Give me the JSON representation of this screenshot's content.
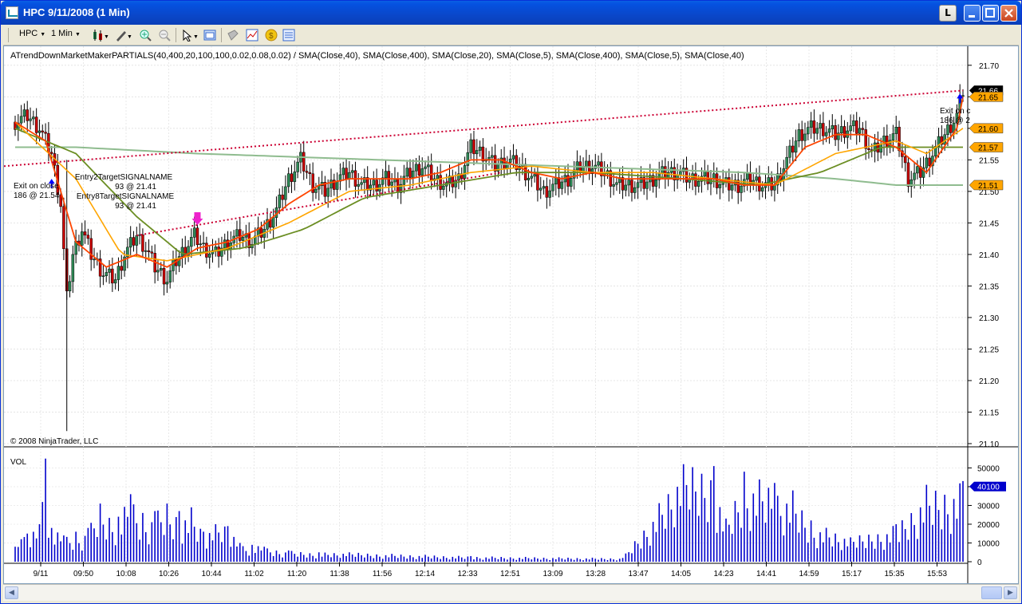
{
  "window": {
    "title": "HPC  9/11/2008 (1 Min)",
    "lock_label": "L"
  },
  "toolbar": {
    "instrument": "HPC",
    "interval": "1 Min"
  },
  "chart": {
    "indicator_line": "ATrendDownMarketMakerPARTIALS(40,400,20,100,100,0.02,0.08,0.02) / SMA(Close,40), SMA(Close,400), SMA(Close,20), SMA(Close,5), SMA(Close,400), SMA(Close,5), SMA(Close,40)",
    "copyright": "© 2008 NinjaTrader, LLC",
    "volume_label": "VOL",
    "annotations": {
      "exit_left_1": "Exit on close",
      "exit_left_2": "186 @ 21.54",
      "entry2_1": "Entry2TargetSIGNALNAME",
      "entry2_2": "93 @ 21.41",
      "entry8_1": "Entry8TargetSIGNALNAME",
      "entry8_2": "93 @ 21.41",
      "exit_right_1": "Exit on c",
      "exit_right_2": "186 @ 2"
    },
    "price_axis": [
      "21.70",
      "21.65",
      "21.60",
      "21.55",
      "21.50",
      "21.45",
      "21.40",
      "21.35",
      "21.30",
      "21.25",
      "21.20",
      "21.15",
      "21.10"
    ],
    "volume_axis": [
      "50000",
      "40000",
      "30000",
      "20000",
      "10000",
      "0"
    ],
    "time_axis": [
      "9/11",
      "09:50",
      "10:08",
      "10:26",
      "10:44",
      "11:02",
      "11:20",
      "11:38",
      "11:56",
      "12:14",
      "12:33",
      "12:51",
      "13:09",
      "13:28",
      "13:47",
      "14:05",
      "14:23",
      "14:41",
      "14:59",
      "15:17",
      "15:35",
      "15:53"
    ],
    "price_tags": [
      {
        "value": "21.66",
        "color": "#000000",
        "text_color": "#ffffff"
      },
      {
        "value": "21.65",
        "color": "#ffa500",
        "text_color": "#000000"
      },
      {
        "value": "21.60",
        "color": "#ffa500",
        "text_color": "#000000"
      },
      {
        "value": "21.57",
        "color": "#ffa500",
        "text_color": "#000000"
      },
      {
        "value": "21.51",
        "color": "#ffa500",
        "text_color": "#000000"
      }
    ],
    "volume_tag": {
      "value": "40100",
      "color": "#0000cc"
    },
    "colors": {
      "up_candle": "#2e8b57",
      "down_candle": "#cc0000",
      "sma_orange": "#ffa500",
      "sma_dark": "#6b8e23",
      "sma_slow": "#8fbc8f",
      "trend_line": "#cc0033",
      "volume_bar": "#0000cc"
    }
  },
  "chart_data": {
    "type": "candlestick",
    "symbol": "HPC",
    "ylim": [
      21.1,
      21.72
    ],
    "close_path": [
      [
        0,
        21.61
      ],
      [
        4,
        21.62
      ],
      [
        8,
        21.6
      ],
      [
        12,
        21.56
      ],
      [
        15,
        21.48
      ],
      [
        17,
        21.33
      ],
      [
        19,
        21.4
      ],
      [
        22,
        21.44
      ],
      [
        25,
        21.4
      ],
      [
        29,
        21.37
      ],
      [
        33,
        21.36
      ],
      [
        36,
        21.4
      ],
      [
        40,
        21.43
      ],
      [
        43,
        21.41
      ],
      [
        46,
        21.38
      ],
      [
        50,
        21.36
      ],
      [
        53,
        21.39
      ],
      [
        56,
        21.41
      ],
      [
        59,
        21.43
      ],
      [
        62,
        21.41
      ],
      [
        66,
        21.4
      ],
      [
        70,
        21.42
      ],
      [
        74,
        21.43
      ],
      [
        78,
        21.42
      ],
      [
        82,
        21.44
      ],
      [
        86,
        21.47
      ],
      [
        90,
        21.52
      ],
      [
        94,
        21.55
      ],
      [
        98,
        21.51
      ],
      [
        102,
        21.5
      ],
      [
        106,
        21.52
      ],
      [
        110,
        21.53
      ],
      [
        114,
        21.51
      ],
      [
        118,
        21.51
      ],
      [
        122,
        21.52
      ],
      [
        126,
        21.51
      ],
      [
        130,
        21.53
      ],
      [
        134,
        21.54
      ],
      [
        138,
        21.52
      ],
      [
        142,
        21.51
      ],
      [
        146,
        21.52
      ],
      [
        150,
        21.57
      ],
      [
        154,
        21.56
      ],
      [
        158,
        21.54
      ],
      [
        162,
        21.55
      ],
      [
        166,
        21.54
      ],
      [
        170,
        21.52
      ],
      [
        174,
        21.5
      ],
      [
        178,
        21.51
      ],
      [
        182,
        21.52
      ],
      [
        186,
        21.54
      ],
      [
        190,
        21.54
      ],
      [
        194,
        21.53
      ],
      [
        198,
        21.51
      ],
      [
        202,
        21.51
      ],
      [
        206,
        21.51
      ],
      [
        210,
        21.52
      ],
      [
        214,
        21.53
      ],
      [
        218,
        21.53
      ],
      [
        222,
        21.52
      ],
      [
        226,
        21.52
      ],
      [
        230,
        21.52
      ],
      [
        234,
        21.51
      ],
      [
        238,
        21.51
      ],
      [
        242,
        21.52
      ],
      [
        246,
        21.51
      ],
      [
        250,
        21.51
      ],
      [
        254,
        21.55
      ],
      [
        258,
        21.59
      ],
      [
        262,
        21.6
      ],
      [
        266,
        21.6
      ],
      [
        270,
        21.59
      ],
      [
        274,
        21.6
      ],
      [
        278,
        21.6
      ],
      [
        282,
        21.56
      ],
      [
        286,
        21.58
      ],
      [
        290,
        21.59
      ],
      [
        294,
        21.52
      ],
      [
        298,
        21.53
      ],
      [
        302,
        21.56
      ],
      [
        306,
        21.59
      ],
      [
        310,
        21.62
      ],
      [
        312,
        21.66
      ]
    ],
    "volume_series": [
      [
        0,
        8000
      ],
      [
        2,
        12000
      ],
      [
        4,
        15000
      ],
      [
        8,
        20000
      ],
      [
        10,
        55000
      ],
      [
        12,
        18000
      ],
      [
        16,
        14000
      ],
      [
        20,
        16000
      ],
      [
        24,
        18000
      ],
      [
        28,
        31000
      ],
      [
        34,
        24000
      ],
      [
        38,
        36000
      ],
      [
        42,
        26000
      ],
      [
        46,
        27000
      ],
      [
        50,
        31000
      ],
      [
        54,
        27000
      ],
      [
        58,
        29000
      ],
      [
        62,
        16000
      ],
      [
        66,
        20000
      ],
      [
        70,
        19000
      ],
      [
        74,
        10000
      ],
      [
        78,
        9000
      ],
      [
        82,
        8000
      ],
      [
        90,
        6000
      ],
      [
        100,
        5000
      ],
      [
        110,
        5000
      ],
      [
        150,
        3000
      ],
      [
        200,
        2000
      ],
      [
        220,
        52000
      ],
      [
        230,
        51000
      ],
      [
        234,
        23000
      ],
      [
        240,
        48000
      ],
      [
        250,
        42000
      ],
      [
        256,
        38000
      ],
      [
        262,
        22000
      ],
      [
        275,
        13000
      ],
      [
        290,
        20000
      ],
      [
        300,
        41000
      ],
      [
        312,
        43000
      ]
    ],
    "sma_fast_path": [
      [
        0,
        21.61
      ],
      [
        10,
        21.58
      ],
      [
        20,
        21.42
      ],
      [
        30,
        21.38
      ],
      [
        40,
        21.4
      ],
      [
        50,
        21.38
      ],
      [
        60,
        21.41
      ],
      [
        70,
        21.42
      ],
      [
        80,
        21.44
      ],
      [
        90,
        21.48
      ],
      [
        100,
        21.51
      ],
      [
        110,
        21.52
      ],
      [
        120,
        21.52
      ],
      [
        130,
        21.52
      ],
      [
        140,
        21.53
      ],
      [
        150,
        21.55
      ],
      [
        160,
        21.55
      ],
      [
        170,
        21.53
      ],
      [
        180,
        21.52
      ],
      [
        190,
        21.53
      ],
      [
        200,
        21.52
      ],
      [
        210,
        21.52
      ],
      [
        220,
        21.52
      ],
      [
        230,
        21.52
      ],
      [
        240,
        21.51
      ],
      [
        250,
        21.51
      ],
      [
        260,
        21.57
      ],
      [
        270,
        21.59
      ],
      [
        280,
        21.59
      ],
      [
        290,
        21.57
      ],
      [
        300,
        21.53
      ],
      [
        310,
        21.6
      ],
      [
        312,
        21.65
      ]
    ],
    "sma_mid_path": [
      [
        0,
        21.61
      ],
      [
        20,
        21.52
      ],
      [
        35,
        21.4
      ],
      [
        50,
        21.39
      ],
      [
        70,
        21.41
      ],
      [
        90,
        21.45
      ],
      [
        110,
        21.5
      ],
      [
        130,
        21.51
      ],
      [
        150,
        21.53
      ],
      [
        170,
        21.54
      ],
      [
        190,
        21.53
      ],
      [
        210,
        21.53
      ],
      [
        230,
        21.52
      ],
      [
        250,
        21.51
      ],
      [
        270,
        21.56
      ],
      [
        290,
        21.58
      ],
      [
        300,
        21.56
      ],
      [
        312,
        21.6
      ]
    ],
    "sma_40_path": [
      [
        0,
        21.6
      ],
      [
        20,
        21.56
      ],
      [
        40,
        21.46
      ],
      [
        55,
        21.4
      ],
      [
        75,
        21.41
      ],
      [
        95,
        21.44
      ],
      [
        115,
        21.49
      ],
      [
        140,
        21.51
      ],
      [
        165,
        21.53
      ],
      [
        190,
        21.53
      ],
      [
        220,
        21.52
      ],
      [
        245,
        21.51
      ],
      [
        265,
        21.53
      ],
      [
        285,
        21.57
      ],
      [
        300,
        21.57
      ],
      [
        312,
        21.57
      ]
    ],
    "sma_400_path": [
      [
        0,
        21.57
      ],
      [
        20,
        21.57
      ],
      [
        60,
        21.56
      ],
      [
        120,
        21.55
      ],
      [
        180,
        21.54
      ],
      [
        240,
        21.53
      ],
      [
        270,
        21.52
      ],
      [
        290,
        21.51
      ],
      [
        312,
        21.51
      ]
    ],
    "trend_line": [
      [
        0,
        21.54
      ],
      [
        312,
        21.66
      ]
    ]
  }
}
